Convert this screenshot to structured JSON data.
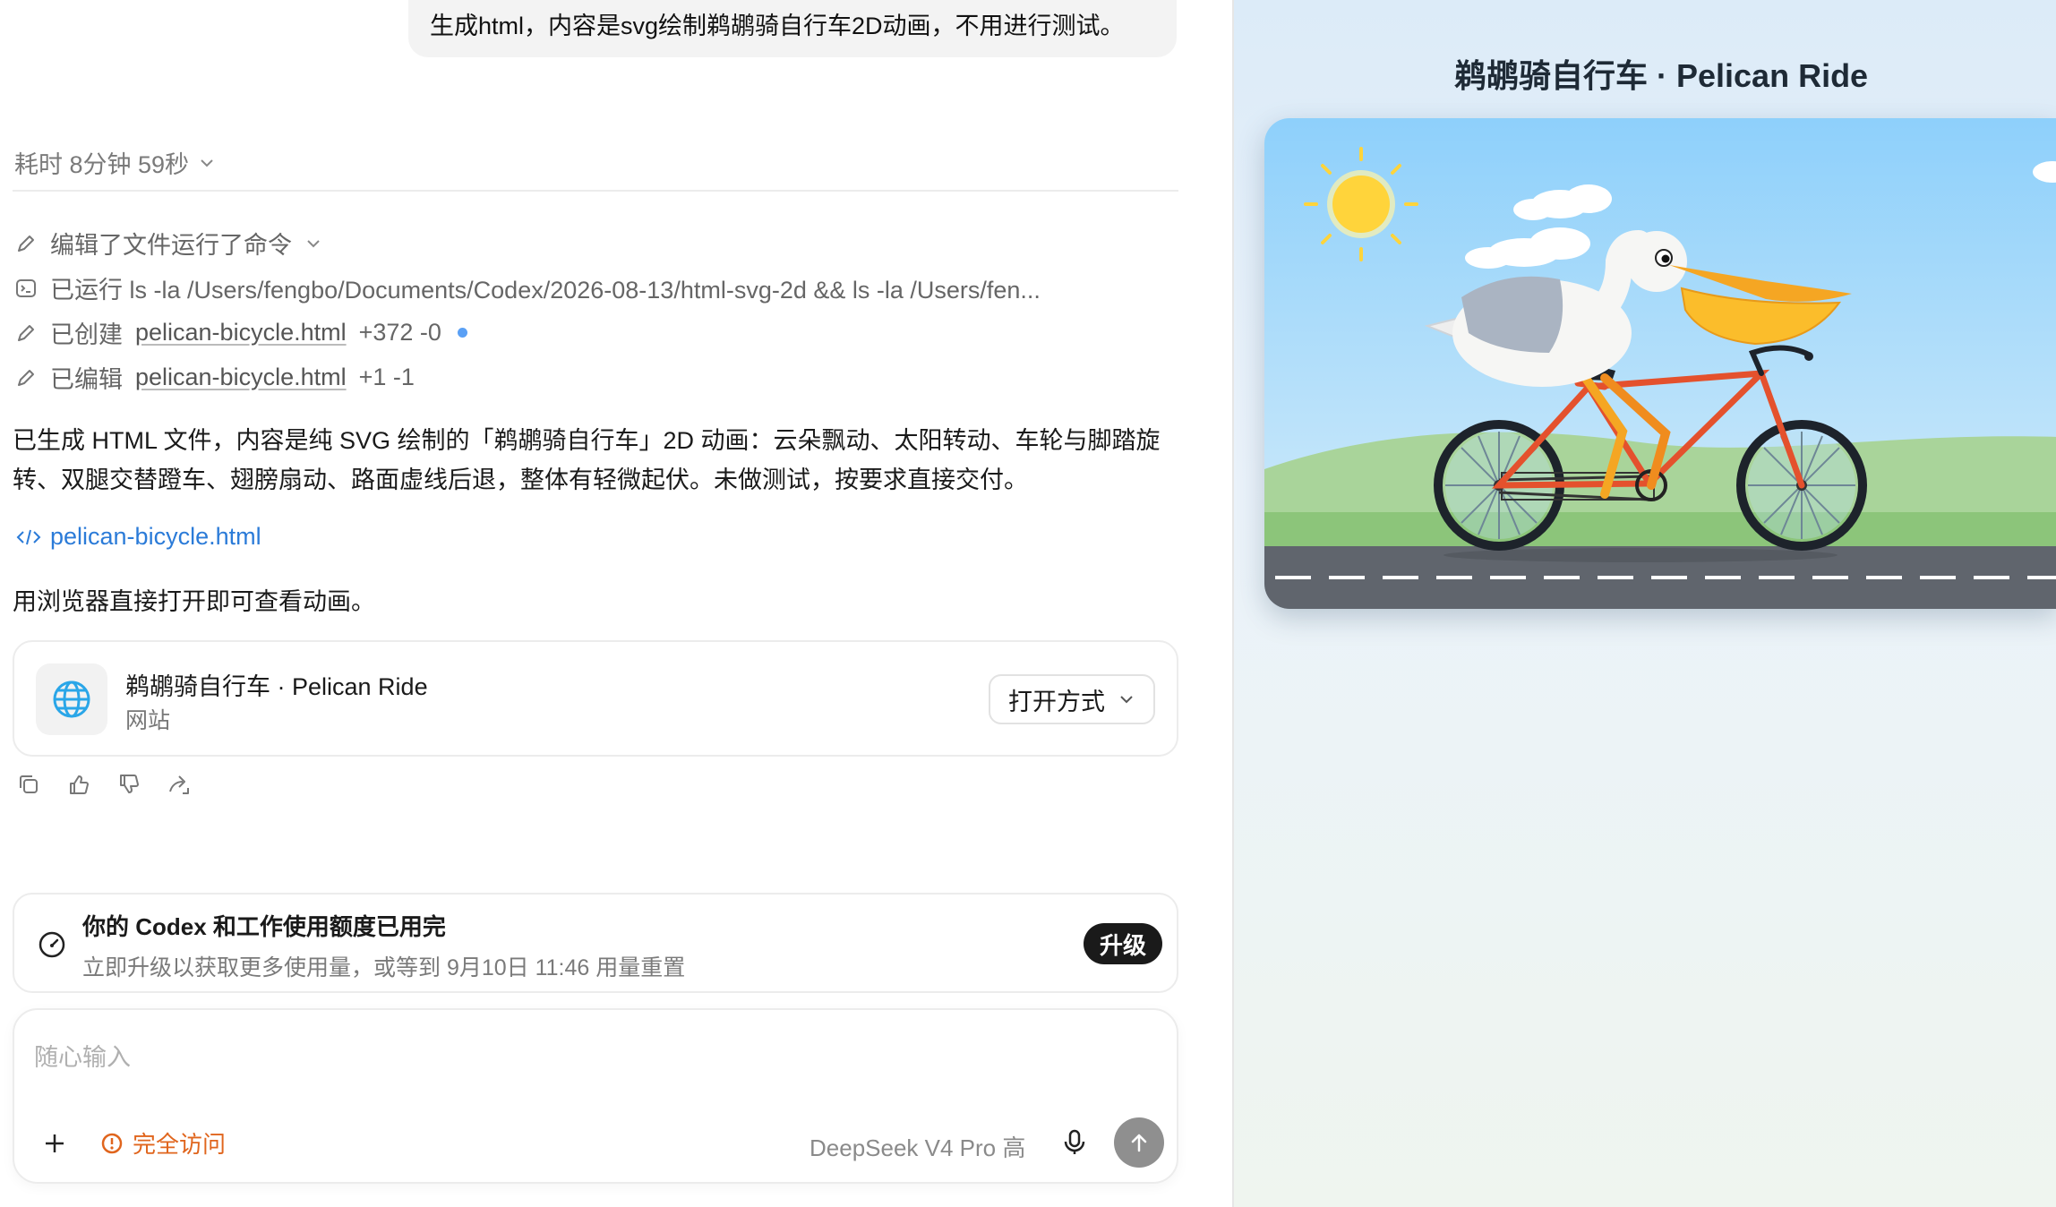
{
  "user_message": "生成html，内容是svg绘制鹈鹕骑自行车2D动画，不用进行测试。",
  "elapsed": "耗时 8分钟 59秒",
  "steps": {
    "summary": "编辑了文件运行了命令",
    "ran": "已运行 ls -la /Users/fengbo/Documents/Codex/2026-08-13/html-svg-2d && ls -la /Users/fen...",
    "created_prefix": "已创建",
    "created_file": "pelican-bicycle.html",
    "created_diff": "+372 -0",
    "edited_prefix": "已编辑",
    "edited_file": "pelican-bicycle.html",
    "edited_diff": "+1 -1"
  },
  "summary_text": "已生成 HTML 文件，内容是纯 SVG 绘制的「鹈鹕骑自行车」2D 动画：云朵飘动、太阳转动、车轮与脚踏旋转、双腿交替蹬车、翅膀扇动、路面虚线后退，整体有轻微起伏。未做测试，按要求直接交付。",
  "file_link": "pelican-bicycle.html",
  "open_hint": "用浏览器直接打开即可查看动画。",
  "site_card": {
    "title": "鹈鹕骑自行车 · Pelican Ride",
    "subtitle": "网站",
    "open_with": "打开方式"
  },
  "quota": {
    "title": "你的 Codex 和工作使用额度已用完",
    "subtitle": "立即升级以获取更多使用量，或等到 9月10日 11:46 用量重置",
    "upgrade": "升级"
  },
  "composer": {
    "placeholder": "随心输入",
    "access": "完全访问",
    "model": "DeepSeek V4 Pro  高"
  },
  "preview": {
    "title": "鹈鹕骑自行车 · Pelican Ride"
  },
  "colors": {
    "accent_link": "#2b7bd8",
    "warning": "#e0651d",
    "bike_frame": "#e4512d",
    "beak": "#f5a623"
  }
}
